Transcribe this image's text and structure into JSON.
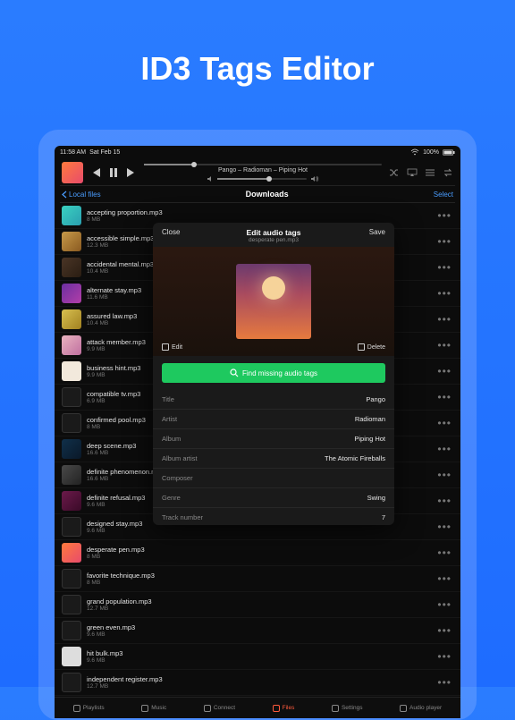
{
  "hero": {
    "title": "ID3 Tags Editor"
  },
  "status": {
    "time": "11:58 AM",
    "date": "Sat Feb 15",
    "battery": "100%"
  },
  "player": {
    "now_playing": "Pango – Radioman – Piping Hot"
  },
  "nav": {
    "back": "Local files",
    "title": "Downloads",
    "select": "Select"
  },
  "files": [
    {
      "name": "accepting proportion.mp3",
      "size": "8 MB",
      "thumb": "t1"
    },
    {
      "name": "accessible simple.mp3",
      "size": "12.3 MB",
      "thumb": "t2"
    },
    {
      "name": "accidental mental.mp3",
      "size": "10.4 MB",
      "thumb": "t3"
    },
    {
      "name": "alternate stay.mp3",
      "size": "11.6 MB",
      "thumb": "t4"
    },
    {
      "name": "assured law.mp3",
      "size": "10.4 MB",
      "thumb": "t5"
    },
    {
      "name": "attack member.mp3",
      "size": "9.9 MB",
      "thumb": "t6"
    },
    {
      "name": "business hint.mp3",
      "size": "9.9 MB",
      "thumb": "t7"
    },
    {
      "name": "compatible tv.mp3",
      "size": "6.9 MB",
      "thumb": "t8"
    },
    {
      "name": "confirmed pool.mp3",
      "size": "8 MB",
      "thumb": "t8"
    },
    {
      "name": "deep scene.mp3",
      "size": "16.6 MB",
      "thumb": "t9"
    },
    {
      "name": "definite phenomenon.mp3",
      "size": "16.6 MB",
      "thumb": "t10"
    },
    {
      "name": "definite refusal.mp3",
      "size": "9.6 MB",
      "thumb": "t11"
    },
    {
      "name": "designed stay.mp3",
      "size": "9.6 MB",
      "thumb": "t8"
    },
    {
      "name": "desperate pen.mp3",
      "size": "8 MB",
      "thumb": "t12"
    },
    {
      "name": "favorite technique.mp3",
      "size": "8 MB",
      "thumb": "t8"
    },
    {
      "name": "grand population.mp3",
      "size": "12.7 MB",
      "thumb": "t8"
    },
    {
      "name": "green even.mp3",
      "size": "9.6 MB",
      "thumb": "t8"
    },
    {
      "name": "hit bulk.mp3",
      "size": "9.6 MB",
      "thumb": "t13"
    },
    {
      "name": "independent register.mp3",
      "size": "12.7 MB",
      "thumb": "t8"
    }
  ],
  "tabs": [
    {
      "label": "Playlists"
    },
    {
      "label": "Music"
    },
    {
      "label": "Connect"
    },
    {
      "label": "Files"
    },
    {
      "label": "Settings"
    },
    {
      "label": "Audio player"
    }
  ],
  "modal": {
    "close": "Close",
    "title": "Edit audio tags",
    "filename": "desperate pen.mp3",
    "save": "Save",
    "edit": "Edit",
    "delete": "Delete",
    "find_button": "Find missing audio tags",
    "fields": [
      {
        "label": "Title",
        "value": "Pango"
      },
      {
        "label": "Artist",
        "value": "Radioman"
      },
      {
        "label": "Album",
        "value": "Piping Hot"
      },
      {
        "label": "Album artist",
        "value": "The Atomic Fireballs"
      },
      {
        "label": "Composer",
        "value": ""
      },
      {
        "label": "Genre",
        "value": "Swing"
      },
      {
        "label": "Track number",
        "value": "7"
      }
    ]
  }
}
